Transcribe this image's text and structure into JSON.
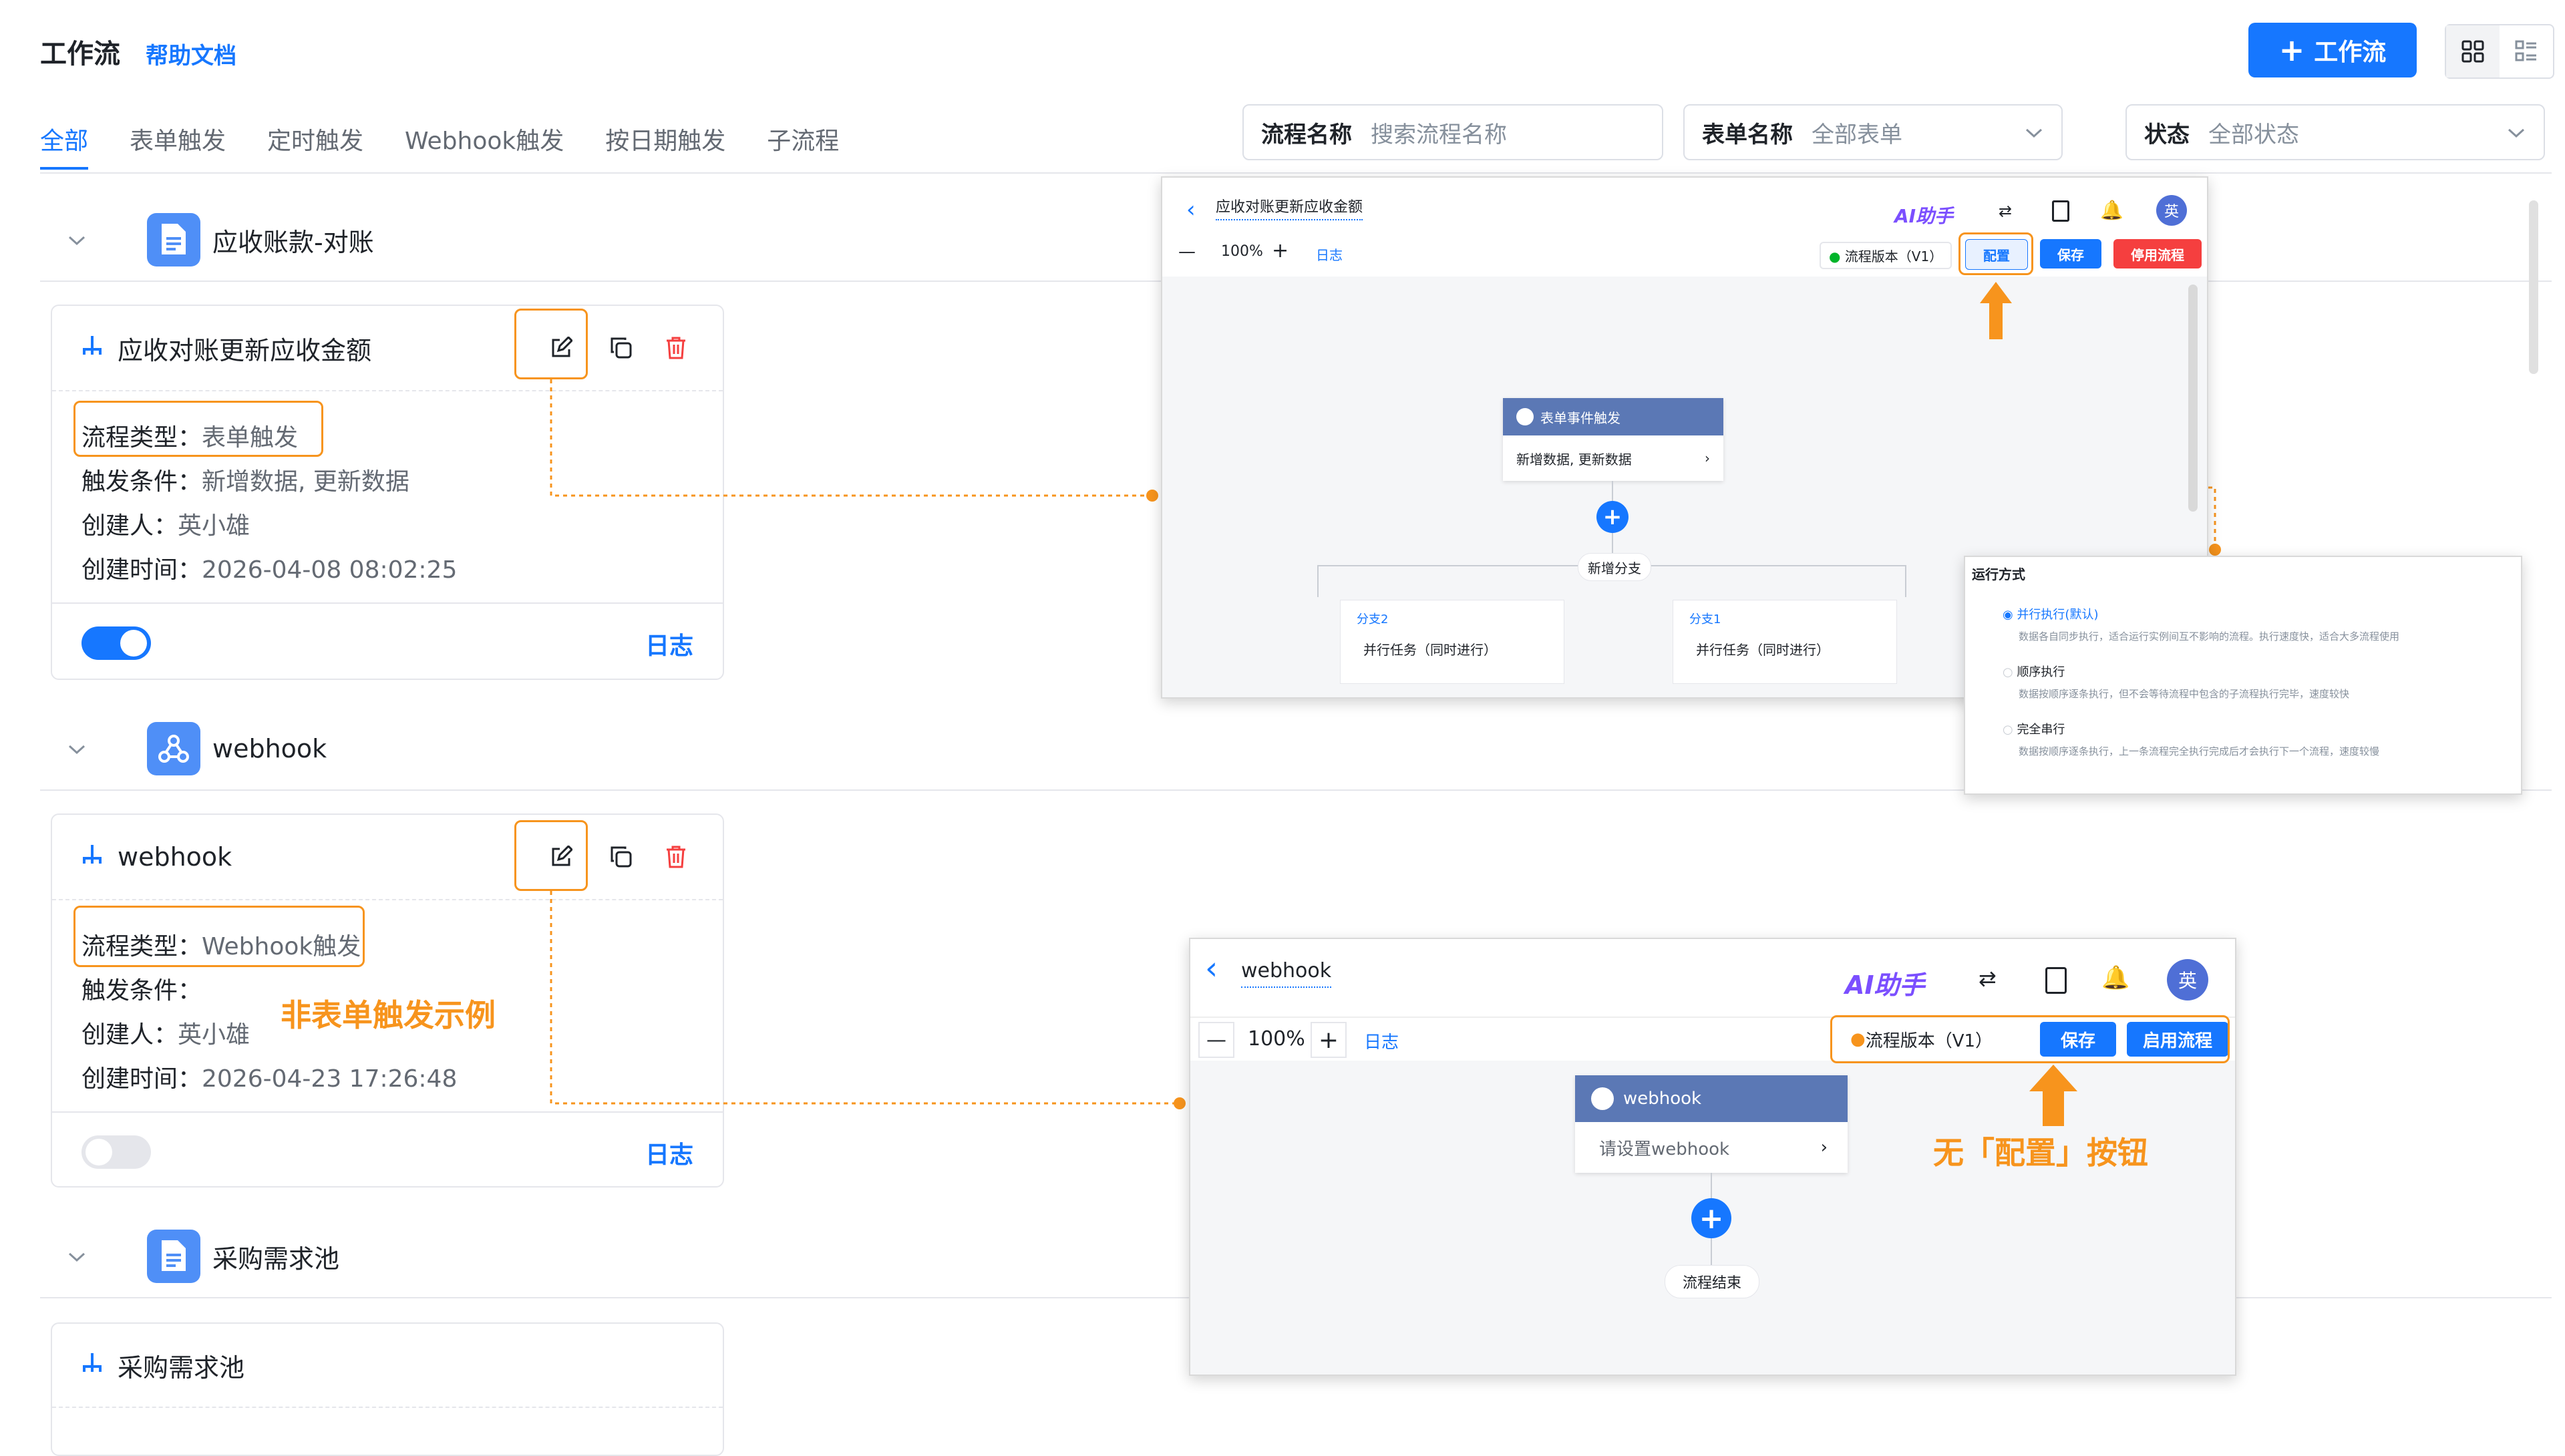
{
  "header": {
    "title": "工作流",
    "help_link": "帮助文档",
    "new_button": "工作流"
  },
  "tabs": [
    {
      "label": "全部",
      "active": true
    },
    {
      "label": "表单触发"
    },
    {
      "label": "定时触发"
    },
    {
      "label": "Webhook触发"
    },
    {
      "label": "按日期触发"
    },
    {
      "label": "子流程"
    }
  ],
  "filters": {
    "flow_name": {
      "label": "流程名称",
      "placeholder": "搜索流程名称"
    },
    "form_name": {
      "label": "表单名称",
      "value": "全部表单"
    },
    "status": {
      "label": "状态",
      "value": "全部状态"
    }
  },
  "groups": [
    {
      "title": "应收账款-对账",
      "icon": "document-icon",
      "color": "#4f8ff7"
    },
    {
      "title": "webhook",
      "icon": "webhook-icon",
      "color": "#4f8ff7"
    },
    {
      "title": "采购需求池",
      "icon": "document-icon",
      "color": "#4f8ff7"
    }
  ],
  "cards": [
    {
      "name": "应收对账更新应收金额",
      "type_label": "流程类型：",
      "type_value": "表单触发",
      "cond_label": "触发条件：",
      "cond_value": "新增数据, 更新数据",
      "creator_label": "创建人：",
      "creator_value": "英小雄",
      "time_label": "创建时间：",
      "time_value": "2026-04-08 08:02:25",
      "enabled": true,
      "log": "日志"
    },
    {
      "name": "webhook",
      "type_label": "流程类型：",
      "type_value": "Webhook触发",
      "cond_label": "触发条件：",
      "cond_value": "",
      "creator_label": "创建人：",
      "creator_value": "英小雄",
      "time_label": "创建时间：",
      "time_value": "2026-04-23 17:26:48",
      "enabled": false,
      "log": "日志"
    },
    {
      "name": "采购需求池"
    }
  ],
  "annotations": {
    "non_form_example": "非表单触发示例",
    "no_config_button": "无「配置」按钮"
  },
  "shot1": {
    "title": "应收对账更新应收金额",
    "ai": "AI助手",
    "avatar": "英",
    "zoom": "100%",
    "log": "日志",
    "version": "流程版本（V1）",
    "config": "配置",
    "save": "保存",
    "disable": "停用流程",
    "trigger_node": "表单事件触发",
    "trigger_detail": "新增数据, 更新数据",
    "add_branch": "新增分支",
    "branch2_label": "分支2",
    "branch2_task": "并行任务（同时进行）",
    "branch1_label": "分支1",
    "branch1_task": "并行任务（同时进行）"
  },
  "run_mode": {
    "title": "运行方式",
    "options": [
      {
        "label": "并行执行(默认)",
        "desc": "数据各自同步执行，适合运行实例间互不影响的流程。执行速度快，适合大多流程使用",
        "selected": true
      },
      {
        "label": "顺序执行",
        "desc": "数据按顺序逐条执行，但不会等待流程中包含的子流程执行完毕，速度较快",
        "selected": false
      },
      {
        "label": "完全串行",
        "desc": "数据按顺序逐条执行，上一条流程完全执行完成后才会执行下一个流程，速度较慢",
        "selected": false
      }
    ]
  },
  "shot2": {
    "title": "webhook",
    "ai": "AI助手",
    "avatar": "英",
    "zoom": "100%",
    "log": "日志",
    "version": "流程版本（V1）",
    "save": "保存",
    "enable": "启用流程",
    "node": "webhook",
    "node_detail": "请设置webhook",
    "end": "流程结束"
  },
  "colors": {
    "primary": "#1677ff",
    "accent": "#f7941d",
    "danger": "#f53f3f",
    "node_header": "#5b78b5"
  }
}
